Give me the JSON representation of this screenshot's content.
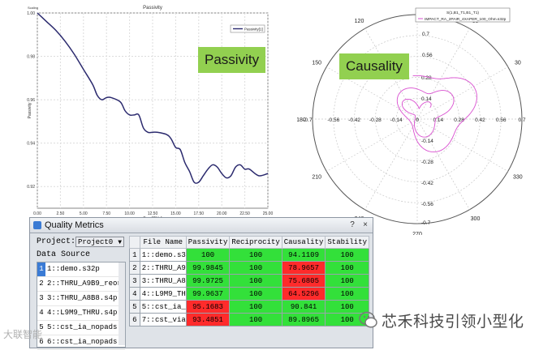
{
  "passivity_chart": {
    "overlay_label": "Passivity",
    "chart_data": {
      "type": "line",
      "title": "Passivity",
      "xlabel": "Freq[GHz]",
      "ylabel": "Passivity",
      "legend": "Passivity[1]",
      "y_axis_top_text": "Scaling",
      "x_ticks": [
        "0.00",
        "2.50",
        "5.00",
        "7.50",
        "10.00",
        "12.50",
        "15.00",
        "17.50",
        "20.00",
        "22.50",
        "25.00"
      ],
      "y_ticks": [
        "1.00",
        "0.98",
        "0.96",
        "0.94",
        "0.92"
      ],
      "xlim": [
        0,
        25
      ],
      "ylim": [
        0.91,
        1.0
      ],
      "series": [
        {
          "name": "Passivity[1]",
          "x": [
            0,
            0.5,
            1,
            2,
            3,
            4,
            5,
            6,
            6.5,
            7,
            7.5,
            8,
            9,
            9.5,
            10,
            10.5,
            11,
            11.5,
            12,
            12.5,
            13,
            14,
            14.5,
            15,
            15.5,
            16,
            16.5,
            17,
            17.5,
            18,
            18.5,
            19,
            19.5,
            20,
            20.5,
            21,
            21.5,
            22,
            22.5,
            23,
            24,
            25
          ],
          "y": [
            1.0,
            0.998,
            0.996,
            0.992,
            0.987,
            0.981,
            0.974,
            0.967,
            0.962,
            0.96,
            0.961,
            0.961,
            0.959,
            0.955,
            0.953,
            0.953,
            0.953,
            0.947,
            0.945,
            0.945,
            0.945,
            0.944,
            0.942,
            0.938,
            0.937,
            0.931,
            0.927,
            0.922,
            0.922,
            0.925,
            0.928,
            0.93,
            0.929,
            0.926,
            0.924,
            0.925,
            0.929,
            0.93,
            0.928,
            0.928,
            0.925,
            0.926
          ]
        }
      ]
    }
  },
  "causality_chart": {
    "overlay_label": "Causality",
    "chart_data": {
      "type": "polar",
      "legend_title": "S(1,B1_T1,B1_T1)",
      "legend_entry": "IMPACT_RA_2PAIR_4XAPER_100_Ohm.s32p",
      "angle_labels": [
        "120",
        "150",
        "180",
        "210",
        "240",
        "270",
        "300",
        "330",
        "0",
        "30",
        "60",
        "90"
      ],
      "radial_labels_horizontal": [
        "-0.7",
        "-0.56",
        "-0.42",
        "-0.28",
        "-0.14",
        "0",
        "0.14",
        "0.28",
        "0.42",
        "0.56",
        "0.7"
      ],
      "radial_labels_vertical": [
        "0.28",
        "0.14",
        "-0.14",
        "-0.28",
        "-0.42",
        "-0.56",
        "-0.7"
      ],
      "radial_labels_top": [
        "0.7",
        "0.56"
      ],
      "rmax": 0.7,
      "curve_color": "#d94fd0"
    }
  },
  "quality_metrics": {
    "window_title": "Quality Metrics",
    "title_buttons": [
      "?",
      "×"
    ],
    "project_label": "Project:",
    "project_value": "Project0",
    "data_source_label": "Data Source",
    "data_sources": [
      {
        "num": "1",
        "name": "1::demo.s32p"
      },
      {
        "num": "2",
        "name": "2::THRU_A9B9_reord"
      },
      {
        "num": "3",
        "name": "3::THRU_A8B8.s4p"
      },
      {
        "num": "4",
        "name": "4::L9M9_THRU.s4p"
      },
      {
        "num": "5",
        "name": "5::cst_ia_nopads."
      },
      {
        "num": "6",
        "name": "6::cst_ia_nopads.s"
      }
    ],
    "columns": [
      "",
      "File Name",
      "Passivity",
      "Reciprocity",
      "Causality",
      "Stability"
    ],
    "rows": [
      {
        "n": "1",
        "file": "1::demo.s3",
        "passivity": "100",
        "reciprocity": "100",
        "causality": "94.1109",
        "stability": "100",
        "pcol": "g",
        "ccol": "g"
      },
      {
        "n": "2",
        "file": "2::THRU_A9",
        "passivity": "99.9845",
        "reciprocity": "100",
        "causality": "78.9657",
        "stability": "100",
        "pcol": "g",
        "ccol": "r"
      },
      {
        "n": "3",
        "file": "3::THRU_A8",
        "passivity": "99.9725",
        "reciprocity": "100",
        "causality": "75.6805",
        "stability": "100",
        "pcol": "g",
        "ccol": "r"
      },
      {
        "n": "4",
        "file": "4::L9M9_TH",
        "passivity": "99.9637",
        "reciprocity": "100",
        "causality": "64.5296",
        "stability": "100",
        "pcol": "g",
        "ccol": "r"
      },
      {
        "n": "5",
        "file": "5::cst_ia_",
        "passivity": "95.1683",
        "reciprocity": "100",
        "causality": "90.841",
        "stability": "100",
        "pcol": "r",
        "ccol": "g"
      },
      {
        "n": "6",
        "file": "7::cst_via",
        "passivity": "93.4851",
        "reciprocity": "100",
        "causality": "89.8965",
        "stability": "100",
        "pcol": "r",
        "ccol": "g"
      }
    ]
  },
  "watermark": {
    "left_text": "大联智能",
    "right_text": "芯禾科技引领小型化"
  },
  "colors": {
    "green": "#33e03a",
    "red": "#ff2b2b",
    "overlay": "#92d050",
    "line": "#2b2a6e",
    "polar": "#d94fd0"
  }
}
